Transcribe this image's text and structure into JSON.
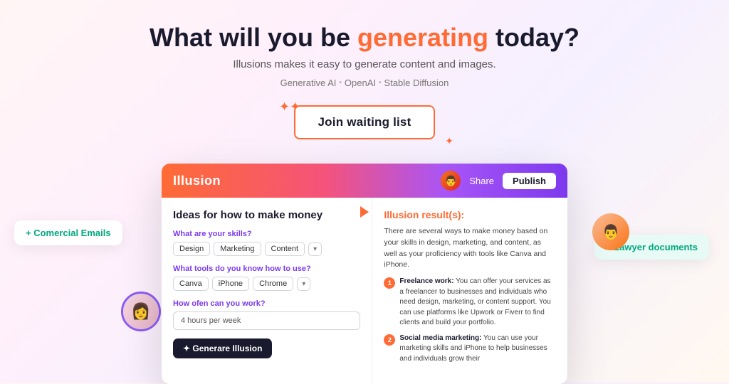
{
  "hero": {
    "title_start": "What will you be ",
    "title_highlight": "generating",
    "title_end": " today?",
    "subtitle": "Illusions makes it easy to generate content and images.",
    "tag1": "Generative AI",
    "tag2": "OpenAI",
    "tag3": "Stable Diffusion",
    "cta_label": "Join waiting list"
  },
  "float_cards": {
    "left_label": "+ Comercial Emails",
    "right_label": "+ Lawyer documents"
  },
  "app": {
    "logo": "Illusion",
    "share_label": "Share",
    "publish_label": "Publish",
    "left_title": "Ideas for how to make money",
    "skill_label": "What are your skills?",
    "skill_tags": [
      "Design",
      "Marketing",
      "Content"
    ],
    "tools_label": "What tools do you know how to use?",
    "tools_tags": [
      "Canva",
      "iPhone",
      "Chrome"
    ],
    "frequency_label": "How ofen can you work?",
    "frequency_value": "4 hours per week",
    "generate_btn": "✦ Generare Illusion",
    "result_title": "Illusion result(s):",
    "result_intro": "There are several ways to make money based on your skills in design, marketing, and content, as well as your proficiency with tools like Canva and iPhone.",
    "result_items": [
      {
        "num": "1",
        "bold": "Freelance work:",
        "text": " You can offer your services as a freelancer to businesses and individuals who need design, marketing, or content support. You can use platforms like Upwork or Fiverr to find clients and build your portfolio."
      },
      {
        "num": "2",
        "bold": "Social media marketing:",
        "text": " You can use your marketing skills and iPhone to help businesses and individuals grow their"
      }
    ]
  }
}
